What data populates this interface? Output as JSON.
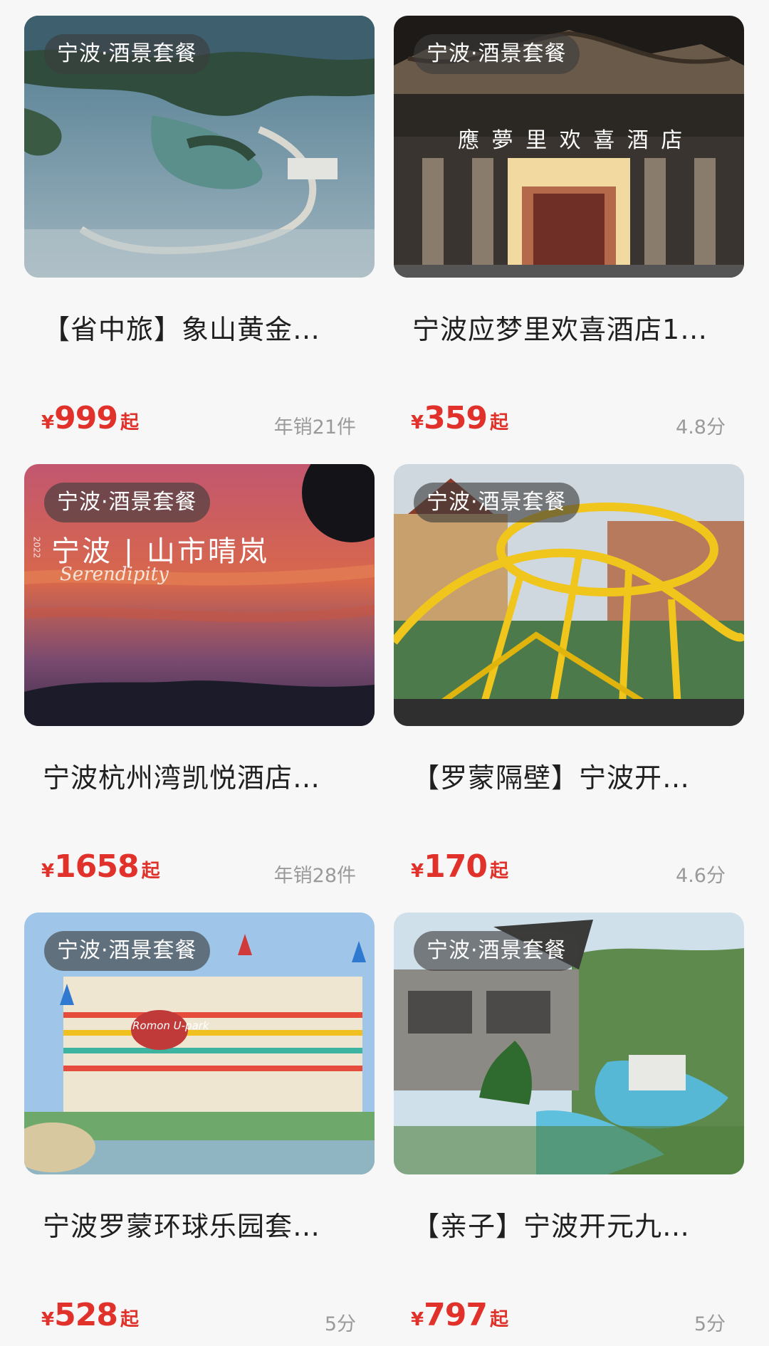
{
  "cards": [
    {
      "tag": "宁波·酒景套餐",
      "title": "【省中旅】象山黄金…",
      "currency": "¥",
      "price": "999",
      "price_suffix": "起",
      "meta": "年销21件",
      "image_icon": "coastal-harbor-photo"
    },
    {
      "tag": "宁波·酒景套餐",
      "title": "宁波应梦里欢喜酒店1…",
      "currency": "¥",
      "price": "359",
      "price_suffix": "起",
      "meta": "4.8分",
      "image_icon": "hotel-entrance-photo",
      "image_sign": "應 夢 里 欢 喜 酒 店"
    },
    {
      "tag": "宁波·酒景套餐",
      "title": "宁波杭州湾凯悦酒店…",
      "currency": "¥",
      "price": "1658",
      "price_suffix": "起",
      "meta": "年销28件",
      "image_icon": "sunset-sky-photo",
      "image_overlay": "宁波 | 山市晴岚",
      "image_script": "Serendipity",
      "image_year": "2022"
    },
    {
      "tag": "宁波·酒景套餐",
      "title": "【罗蒙隔壁】宁波开…",
      "currency": "¥",
      "price": "170",
      "price_suffix": "起",
      "meta": "4.6分",
      "image_icon": "roller-coaster-photo"
    },
    {
      "tag": "宁波·酒景套餐",
      "title": "宁波罗蒙环球乐园套…",
      "currency": "¥",
      "price": "528",
      "price_suffix": "起",
      "meta": "5分",
      "image_icon": "theme-park-castle-photo",
      "image_logo": "Romon U-park"
    },
    {
      "tag": "宁波·酒景套餐",
      "title": "【亲子】宁波开元九…",
      "currency": "¥",
      "price": "797",
      "price_suffix": "起",
      "meta": "5分",
      "image_icon": "resort-pool-photo"
    }
  ],
  "colors": {
    "price": "#e0322b",
    "meta": "#9a9a9a",
    "tag_bg": "rgba(60,60,60,0.62)"
  }
}
